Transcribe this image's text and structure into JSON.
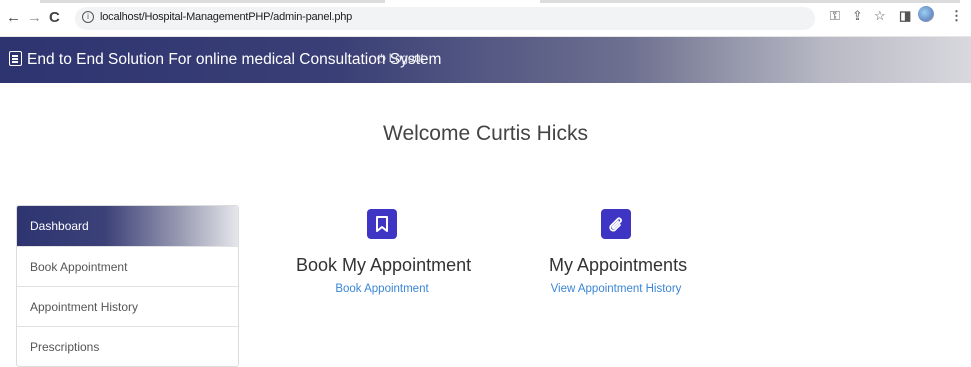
{
  "browser": {
    "url": "localhost/Hospital-ManagementPHP/admin-panel.php",
    "back_icon": "back-arrow-icon",
    "forward_icon": "forward-arrow-icon",
    "reload_icon": "reload-icon"
  },
  "navbar": {
    "brand": "End to End Solution For online medical Consultation System",
    "logout": "Logout"
  },
  "welcome": "Welcome  Curtis Hicks",
  "sidebar": {
    "items": [
      {
        "label": "Dashboard",
        "active": true
      },
      {
        "label": "Book Appointment",
        "active": false
      },
      {
        "label": "Appointment History",
        "active": false
      },
      {
        "label": "Prescriptions",
        "active": false
      }
    ]
  },
  "cards": [
    {
      "icon": "bookmark-icon",
      "title": "Book My Appointment",
      "link": "Book Appointment"
    },
    {
      "icon": "paperclip-icon",
      "title": "My Appointments",
      "link": "View Appointment History"
    }
  ],
  "colors": {
    "navbar_start": "#2e3470",
    "icon_bg": "#3e35c4",
    "link": "#3a86d6"
  }
}
